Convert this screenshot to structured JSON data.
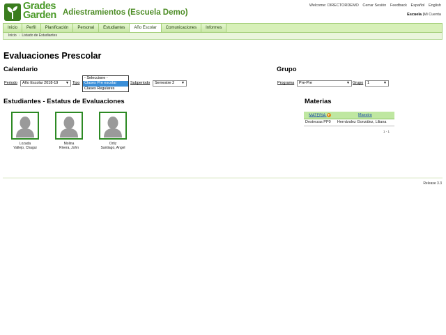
{
  "logo": {
    "line1": "Grades",
    "line2": "Garden"
  },
  "app_title": "Adiestramientos (Escuela Demo)",
  "top_links": {
    "welcome": "Welcome: DIRECTORDEMO",
    "logout": "Cerrar Sesión",
    "feedback": "Feedback",
    "spanish": "Español",
    "english": "English"
  },
  "school_links": {
    "school": "Escuela",
    "separator": "|",
    "my_account": "Mi Cuenta"
  },
  "nav": {
    "tabs": [
      "Inicio",
      "Perfil",
      "Planificación",
      "Personal",
      "Estudiantes",
      "Año Escolar",
      "Comunicaciones",
      "Informes"
    ],
    "active": "Año Escolar"
  },
  "breadcrumb": {
    "home": "Inicio",
    "current": "Listado de Estudiantes"
  },
  "page_title": "Evaluaciones Prescolar",
  "calendario": {
    "heading": "Calendario",
    "periodo_label": "Periodo",
    "periodo_value": "Año Escolar 2018-19",
    "tipo_label": "Tipo",
    "tipo_options": [
      "- Seleccione -",
      "Clases Pre escolar",
      "Clases Regulares"
    ],
    "tipo_highlighted": "Clases Pre escolar",
    "subperiodo_label": "Subperiodo",
    "subperiodo_value": "Semestre 2"
  },
  "grupo": {
    "heading": "Grupo",
    "programa_label": "Programa",
    "programa_value": "Pre-Pre",
    "grupo_label": "Grupo",
    "grupo_value": "1"
  },
  "students_section": {
    "heading": "Estudiantes - Estatus de Evaluaciones",
    "students": [
      {
        "line1": "Lozada",
        "line2": "Vallejo, Chagui"
      },
      {
        "line1": "Molina",
        "line2": "Rivera, John"
      },
      {
        "line1": "Ortiz",
        "line2": "Santiago, Angel"
      }
    ]
  },
  "materias": {
    "heading": "Materias",
    "columns": [
      "MATERIA",
      "Maestro"
    ],
    "rows": [
      {
        "materia": "Destrezas PP0",
        "maestro": "Hernández González, Liliana"
      }
    ],
    "pager": "1 - 1"
  },
  "footer": {
    "release": "Release 3.3"
  },
  "colors": {
    "brand_green": "#4a9a28",
    "nav_bg": "#d7f0b8",
    "avatar_border": "#2d8a24",
    "highlight": "#3b8fd8"
  }
}
